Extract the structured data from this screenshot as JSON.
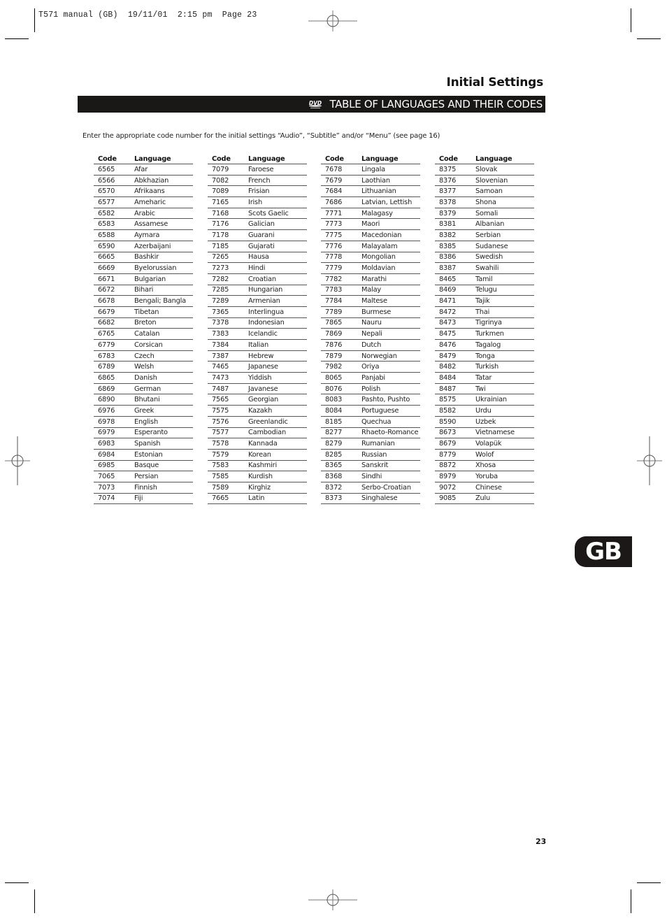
{
  "slug_line": "T571 manual (GB)  19/11/01  2:15 pm  Page 23",
  "header": {
    "section_title": "Initial Settings",
    "banner_icon": "dvd-video-logo-icon",
    "banner_title": "TABLE OF LANGUAGES AND THEIR CODES"
  },
  "intro": "Enter the appropriate code number for the initial settings “Audio”, “Subtitle” and/or “Menu” (see page 16)",
  "table_headers": {
    "code": "Code",
    "language": "Language"
  },
  "columns": [
    [
      [
        "6565",
        "Afar"
      ],
      [
        "6566",
        "Abkhazian"
      ],
      [
        "6570",
        "Afrikaans"
      ],
      [
        "6577",
        "Ameharic"
      ],
      [
        "6582",
        "Arabic"
      ],
      [
        "6583",
        "Assamese"
      ],
      [
        "6588",
        "Aymara"
      ],
      [
        "6590",
        "Azerbaijani"
      ],
      [
        "6665",
        "Bashkir"
      ],
      [
        "6669",
        "Byelorussian"
      ],
      [
        "6671",
        "Bulgarian"
      ],
      [
        "6672",
        "Bihari"
      ],
      [
        "6678",
        "Bengali; Bangla"
      ],
      [
        "6679",
        "Tibetan"
      ],
      [
        "6682",
        "Breton"
      ],
      [
        "6765",
        "Catalan"
      ],
      [
        "6779",
        "Corsican"
      ],
      [
        "6783",
        "Czech"
      ],
      [
        "6789",
        "Welsh"
      ],
      [
        "6865",
        "Danish"
      ],
      [
        "6869",
        "German"
      ],
      [
        "6890",
        "Bhutani"
      ],
      [
        "6976",
        "Greek"
      ],
      [
        "6978",
        "English"
      ],
      [
        "6979",
        "Esperanto"
      ],
      [
        "6983",
        "Spanish"
      ],
      [
        "6984",
        "Estonian"
      ],
      [
        "6985",
        "Basque"
      ],
      [
        "7065",
        "Persian"
      ],
      [
        "7073",
        "Finnish"
      ],
      [
        "7074",
        "Fiji"
      ]
    ],
    [
      [
        "7079",
        "Faroese"
      ],
      [
        "7082",
        "French"
      ],
      [
        "7089",
        "Frisian"
      ],
      [
        "7165",
        "Irish"
      ],
      [
        "7168",
        "Scots Gaelic"
      ],
      [
        "7176",
        "Galician"
      ],
      [
        "7178",
        "Guarani"
      ],
      [
        "7185",
        "Gujarati"
      ],
      [
        "7265",
        "Hausa"
      ],
      [
        "7273",
        "Hindi"
      ],
      [
        "7282",
        "Croatian"
      ],
      [
        "7285",
        "Hungarian"
      ],
      [
        "7289",
        "Armenian"
      ],
      [
        "7365",
        "Interlingua"
      ],
      [
        "7378",
        "Indonesian"
      ],
      [
        "7383",
        "Icelandic"
      ],
      [
        "7384",
        "Italian"
      ],
      [
        "7387",
        "Hebrew"
      ],
      [
        "7465",
        "Japanese"
      ],
      [
        "7473",
        "Yiddish"
      ],
      [
        "7487",
        "Javanese"
      ],
      [
        "7565",
        "Georgian"
      ],
      [
        "7575",
        "Kazakh"
      ],
      [
        "7576",
        "Greenlandic"
      ],
      [
        "7577",
        "Cambodian"
      ],
      [
        "7578",
        "Kannada"
      ],
      [
        "7579",
        "Korean"
      ],
      [
        "7583",
        "Kashmiri"
      ],
      [
        "7585",
        "Kurdish"
      ],
      [
        "7589",
        "Kirghiz"
      ],
      [
        "7665",
        "Latin"
      ]
    ],
    [
      [
        "7678",
        "Lingala"
      ],
      [
        "7679",
        "Laothian"
      ],
      [
        "7684",
        "Lithuanian"
      ],
      [
        "7686",
        "Latvian, Lettish"
      ],
      [
        "7771",
        "Malagasy"
      ],
      [
        "7773",
        "Maori"
      ],
      [
        "7775",
        "Macedonian"
      ],
      [
        "7776",
        "Malayalam"
      ],
      [
        "7778",
        "Mongolian"
      ],
      [
        "7779",
        "Moldavian"
      ],
      [
        "7782",
        "Marathi"
      ],
      [
        "7783",
        "Malay"
      ],
      [
        "7784",
        "Maltese"
      ],
      [
        "7789",
        "Burmese"
      ],
      [
        "7865",
        "Nauru"
      ],
      [
        "7869",
        "Nepali"
      ],
      [
        "7876",
        "Dutch"
      ],
      [
        "7879",
        "Norwegian"
      ],
      [
        "7982",
        "Oriya"
      ],
      [
        "8065",
        "Panjabi"
      ],
      [
        "8076",
        "Polish"
      ],
      [
        "8083",
        "Pashto, Pushto"
      ],
      [
        "8084",
        "Portuguese"
      ],
      [
        "8185",
        "Quechua"
      ],
      [
        "8277",
        "Rhaeto-Romance"
      ],
      [
        "8279",
        "Rumanian"
      ],
      [
        "8285",
        "Russian"
      ],
      [
        "8365",
        "Sanskrit"
      ],
      [
        "8368",
        "Sindhi"
      ],
      [
        "8372",
        "Serbo-Croatian"
      ],
      [
        "8373",
        "Singhalese"
      ]
    ],
    [
      [
        "8375",
        "Slovak"
      ],
      [
        "8376",
        "Slovenian"
      ],
      [
        "8377",
        "Samoan"
      ],
      [
        "8378",
        "Shona"
      ],
      [
        "8379",
        "Somali"
      ],
      [
        "8381",
        "Albanian"
      ],
      [
        "8382",
        "Serbian"
      ],
      [
        "8385",
        "Sudanese"
      ],
      [
        "8386",
        "Swedish"
      ],
      [
        "8387",
        "Swahili"
      ],
      [
        "8465",
        "Tamil"
      ],
      [
        "8469",
        "Telugu"
      ],
      [
        "8471",
        "Tajik"
      ],
      [
        "8472",
        "Thai"
      ],
      [
        "8473",
        "Tigrinya"
      ],
      [
        "8475",
        "Turkmen"
      ],
      [
        "8476",
        "Tagalog"
      ],
      [
        "8479",
        "Tonga"
      ],
      [
        "8482",
        "Turkish"
      ],
      [
        "8484",
        "Tatar"
      ],
      [
        "8487",
        "Twi"
      ],
      [
        "8575",
        "Ukrainian"
      ],
      [
        "8582",
        "Urdu"
      ],
      [
        "8590",
        "Uzbek"
      ],
      [
        "8673",
        "Vietnamese"
      ],
      [
        "8679",
        "Volapük"
      ],
      [
        "8779",
        "Wolof"
      ],
      [
        "8872",
        "Xhosa"
      ],
      [
        "8979",
        "Yoruba"
      ],
      [
        "9072",
        "Chinese"
      ],
      [
        "9085",
        "Zulu"
      ]
    ]
  ],
  "side_tab": "GB",
  "page_number": "23"
}
